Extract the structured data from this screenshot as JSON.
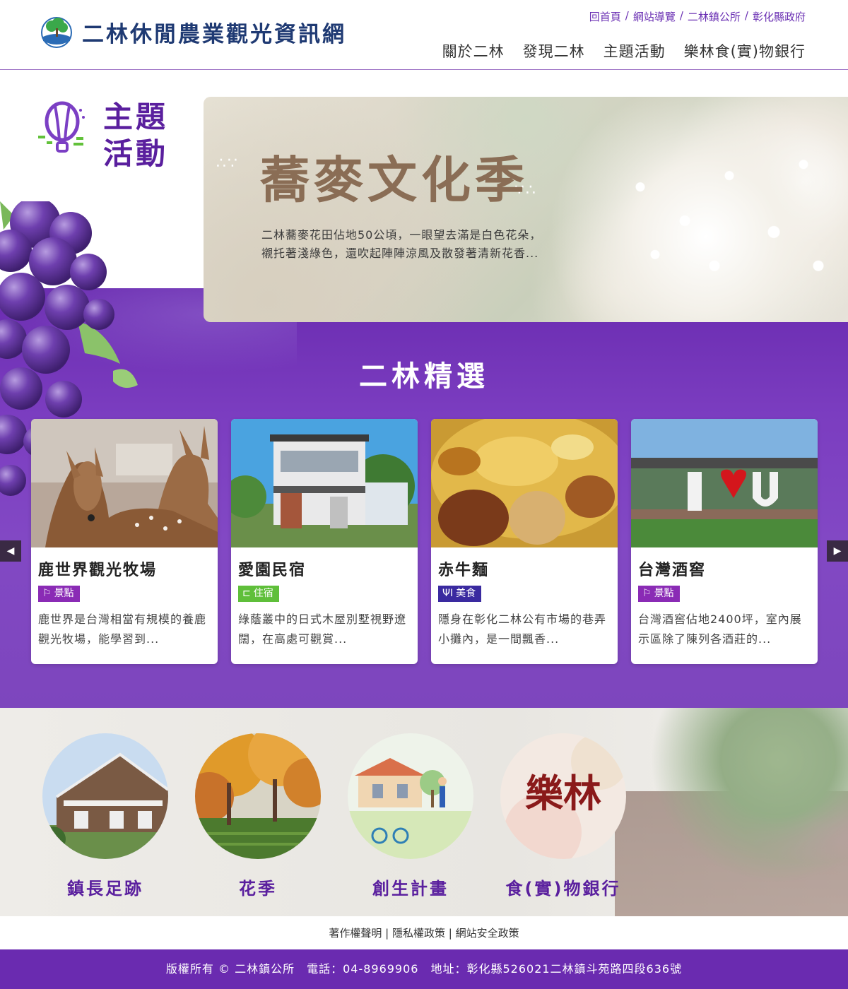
{
  "site": {
    "title": "二林休閒農業觀光資訊網"
  },
  "toplinks": [
    "回首頁",
    "網站導覽",
    "二林鎮公所",
    "彰化縣政府"
  ],
  "mainnav": [
    "關於二林",
    "發現二林",
    "主題活動",
    "樂林食(實)物銀行"
  ],
  "theme": {
    "line1": "主題",
    "line2": "活動"
  },
  "banner": {
    "title": "蕎麥文化季",
    "desc": "二林蕎麥花田佔地50公頃，一眼望去滿是白色花朵，襯托著淺綠色，還吹起陣陣涼風及散發著清新花香..."
  },
  "featured": {
    "title": "二林精選",
    "cards": [
      {
        "title": "鹿世界觀光牧場",
        "tag": "景點",
        "tag_icon": "signpost-icon",
        "tag_color": "#8a2bb5",
        "desc": "鹿世界是台灣相當有規模的養鹿觀光牧場，能學習到..."
      },
      {
        "title": "愛園民宿",
        "tag": "住宿",
        "tag_icon": "bed-icon",
        "tag_color": "#5fbf3a",
        "desc": "綠蔭叢中的日式木屋別墅視野遼闊，在高處可觀賞..."
      },
      {
        "title": "赤牛麵",
        "tag": "美食",
        "tag_icon": "utensils-icon",
        "tag_color": "#3a2aa0",
        "desc": "隱身在彰化二林公有市場的巷弄小攤內，是一間飄香..."
      },
      {
        "title": "台灣酒窖",
        "tag": "景點",
        "tag_icon": "signpost-icon",
        "tag_color": "#8a2bb5",
        "desc": "台灣酒窖佔地2400坪，室內展示區除了陳列各酒莊的..."
      }
    ]
  },
  "circles": [
    {
      "label": "鎮長足跡"
    },
    {
      "label": "花季"
    },
    {
      "label": "創生計畫"
    },
    {
      "label": "食(實)物銀行",
      "logo_text": "樂林"
    }
  ],
  "policy": {
    "a": "著作權聲明",
    "b": "隱私權政策",
    "c": "網站安全政策",
    "sep": "|"
  },
  "footer": {
    "text": "版權所有 © 二林鎮公所　電話：04-8969906　地址：彰化縣526021二林鎮斗苑路四段636號"
  },
  "colors": {
    "brand_purple": "#6a2bb0",
    "title_navy": "#1f3a73"
  }
}
